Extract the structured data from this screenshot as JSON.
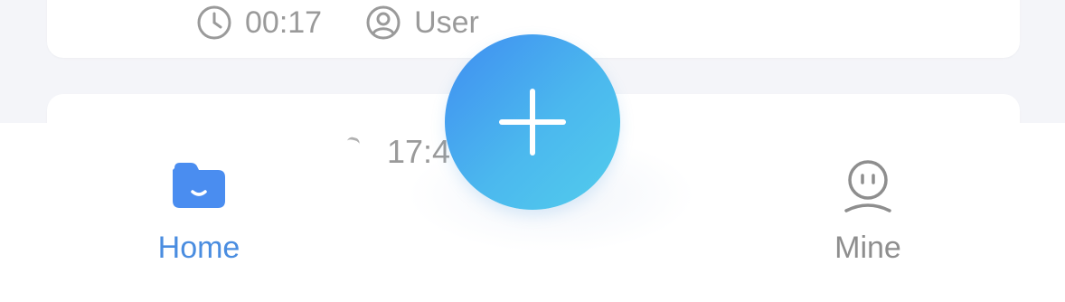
{
  "list": {
    "top_card": {
      "duration": "00:17",
      "user": "User"
    },
    "second_card": {
      "time_partial": "17:4"
    }
  },
  "fab": {
    "icon": "plus-icon"
  },
  "tabbar": {
    "home_label": "Home",
    "home_icon": "folder-icon",
    "mine_label": "Mine",
    "mine_icon": "user-face-icon",
    "active_color": "#4a8de0",
    "inactive_color": "#8e8e8e"
  }
}
